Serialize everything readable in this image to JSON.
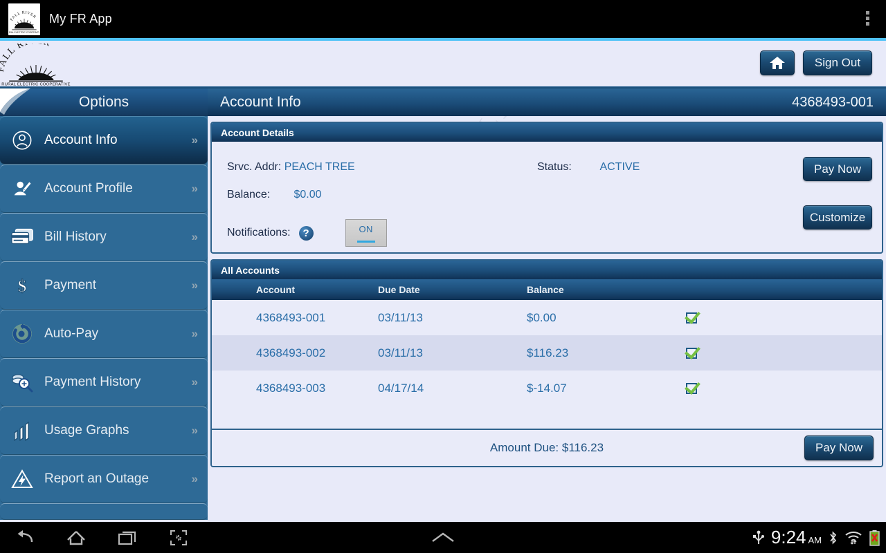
{
  "appbar": {
    "title": "My FR App",
    "logo_text_top": "FALL RIVER",
    "logo_text_bottom": "RURAL ELECTRIC COOPERATIVE",
    "overflow_label": "More options"
  },
  "brandbar": {
    "logo_top": "FALL RIVER",
    "logo_bottom": "RURAL ELECTRIC COOPERATIVE",
    "home_label": "Home",
    "signout_label": "Sign Out"
  },
  "sidebar": {
    "header": "Options",
    "items": [
      {
        "label": "Account Info",
        "icon": "user-circle-icon",
        "selected": true
      },
      {
        "label": "Account Profile",
        "icon": "user-edit-icon",
        "selected": false
      },
      {
        "label": "Bill History",
        "icon": "credit-card-icon",
        "selected": false
      },
      {
        "label": "Payment",
        "icon": "dollar-sign-icon",
        "selected": false
      },
      {
        "label": "Auto-Pay",
        "icon": "refresh-cycle-icon",
        "selected": false
      },
      {
        "label": "Payment History",
        "icon": "coins-search-icon",
        "selected": false
      },
      {
        "label": "Usage Graphs",
        "icon": "bar-chart-icon",
        "selected": false
      },
      {
        "label": "Report an Outage",
        "icon": "warning-bolt-icon",
        "selected": false
      }
    ],
    "chevron": "»"
  },
  "main": {
    "page_title": "Account Info",
    "account_number": "4368493-001",
    "account_details": {
      "header": "Account Details",
      "srvc_addr_label": "Srvc. Addr:",
      "srvc_addr_value": "PEACH TREE",
      "status_label": "Status:",
      "status_value": "ACTIVE",
      "balance_label": "Balance:",
      "balance_value": "$0.00",
      "notifications_label": "Notifications:",
      "help_glyph": "?",
      "toggle_state": "ON",
      "pay_now_label": "Pay Now",
      "customize_label": "Customize"
    },
    "all_accounts": {
      "header": "All Accounts",
      "columns": [
        "Account",
        "Due Date",
        "Balance",
        ""
      ],
      "rows": [
        {
          "account": "4368493-001",
          "due_date": "03/11/13",
          "balance": "$0.00",
          "checked": true
        },
        {
          "account": "4368493-002",
          "due_date": "03/11/13",
          "balance": "$116.23",
          "checked": true
        },
        {
          "account": "4368493-003",
          "due_date": "04/17/14",
          "balance": "$-14.07",
          "checked": true
        }
      ],
      "amount_due_label": "Amount Due:",
      "amount_due_value": "$116.23",
      "pay_now_label": "Pay Now"
    }
  },
  "systembar": {
    "back_icon": "back-arrow-icon",
    "home_icon": "home-icon",
    "recents_icon": "recent-apps-icon",
    "screenshot_icon": "screenshot-icon",
    "expand_icon": "chevron-up-icon",
    "usb_icon": "usb-icon",
    "time": "9:24",
    "ampm": "AM",
    "bluetooth_icon": "bluetooth-icon",
    "wifi_icon": "wifi-icon",
    "battery_icon": "battery-error-icon"
  },
  "colors": {
    "accent_cyan": "#4fc3f7",
    "panel_blue": "#2e6a96",
    "header_blue": "#1b4c78",
    "page_bg": "#e8eaf9",
    "link_blue": "#2a6ea8",
    "check_green": "#76c043"
  }
}
